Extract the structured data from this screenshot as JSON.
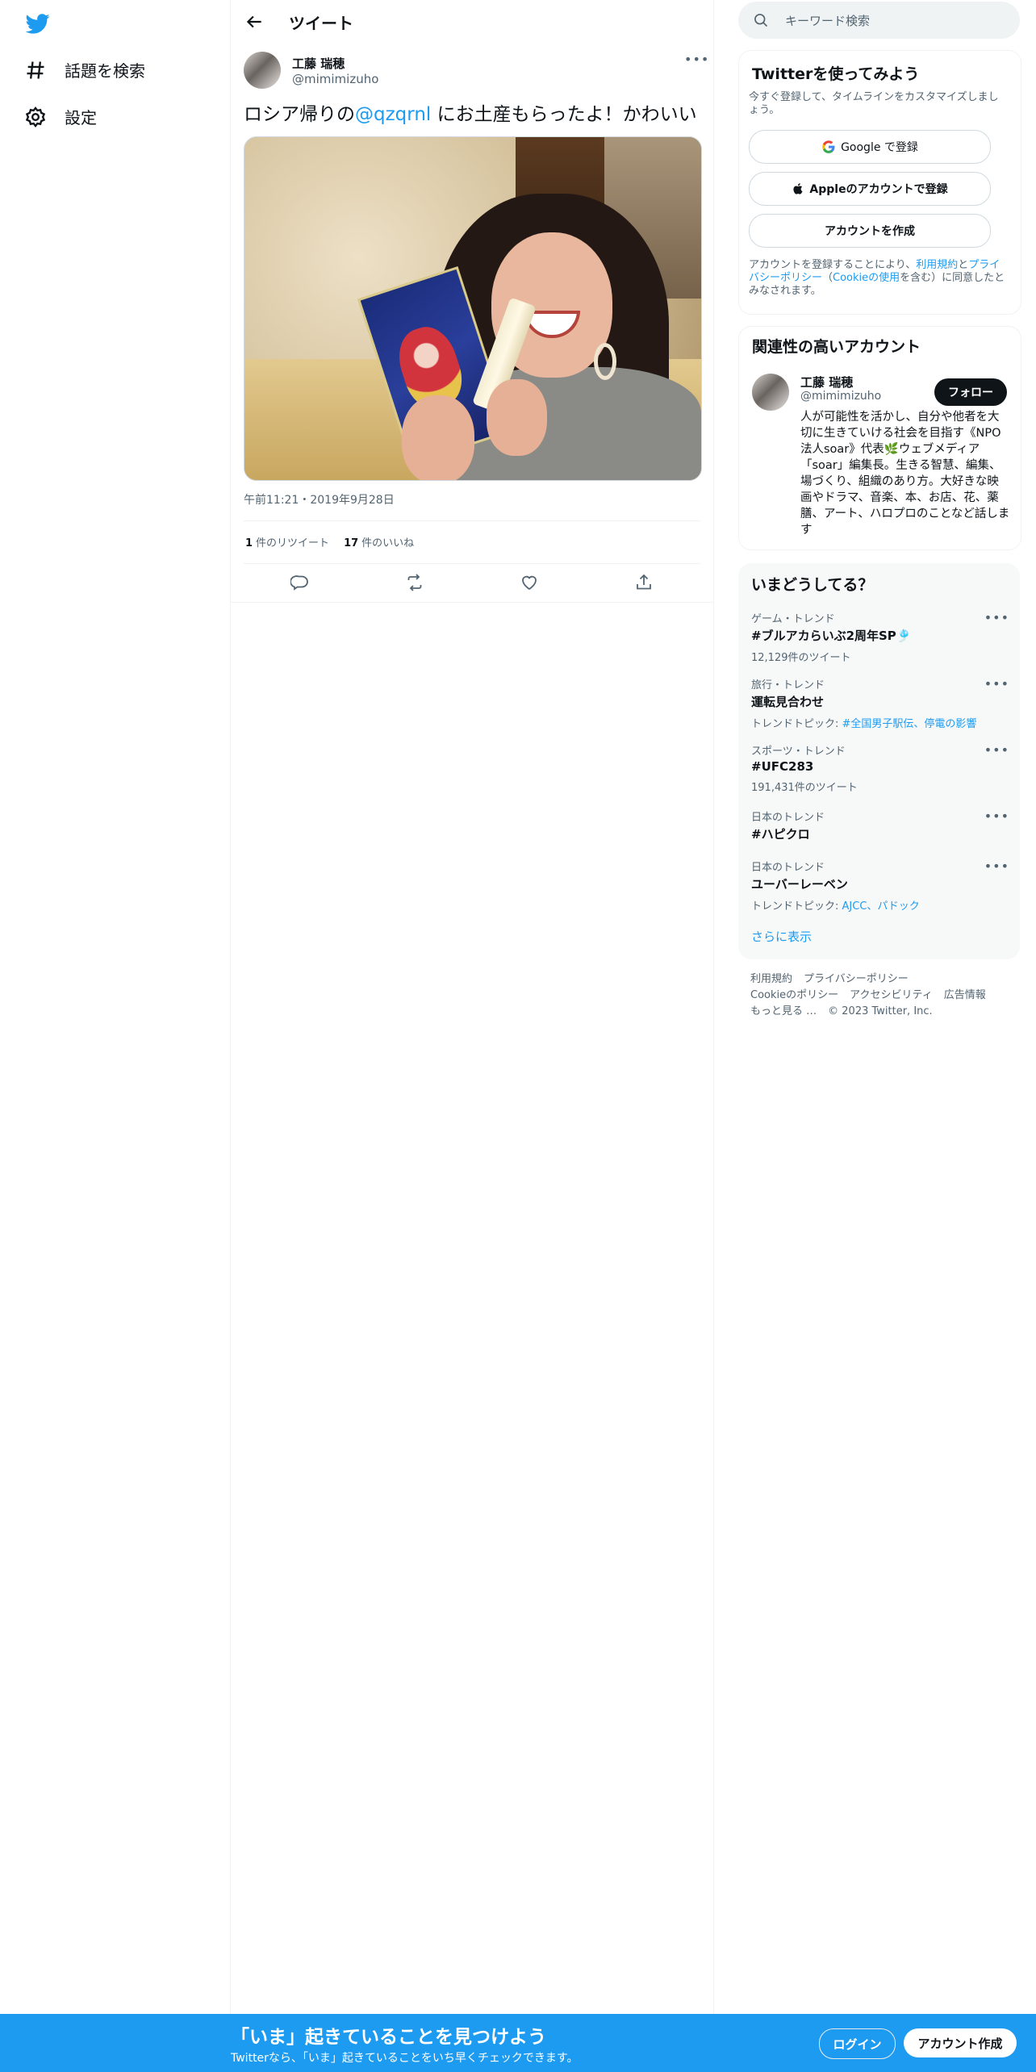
{
  "nav": {
    "items": [
      {
        "label": "話題を検索",
        "icon": "hashtag-icon"
      },
      {
        "label": "設定",
        "icon": "gear-icon"
      }
    ]
  },
  "header": {
    "title": "ツイート"
  },
  "tweet": {
    "author_name": "工藤 瑞穂",
    "author_handle": "@mimimizuho",
    "text_before": "ロシア帰りの",
    "mention": "@qzqrnl",
    "text_after": " にお土産もらったよ！かわいい",
    "timestamp": "午前11:21・2019年9月28日",
    "retweet_count": "1",
    "retweet_label": "件のリツイート",
    "like_count": "17",
    "like_label": "件のいいね"
  },
  "search": {
    "placeholder": "キーワード検索"
  },
  "signup": {
    "title": "Twitterを使ってみよう",
    "description": "今すぐ登録して、タイムラインをカスタマイズしましょう。",
    "google_label": "Google で登録",
    "apple_label": "Appleのアカウントで登録",
    "create_label": "アカウントを作成",
    "terms_pre": "アカウントを登録することにより、",
    "terms_link": "利用規約",
    "terms_mid": "と",
    "privacy_link": "プライバシーポリシー",
    "cookie_pre": "（",
    "cookie_link": "Cookieの使用",
    "terms_post": "を含む）に同意したとみなされます。"
  },
  "related": {
    "title": "関連性の高いアカウント",
    "name": "工藤 瑞穂",
    "handle": "@mimimizuho",
    "follow_label": "フォロー",
    "bio": "人が可能性を活かし、自分や他者を大切に生きていける社会を目指す《NPO法人soar》代表🌿ウェブメディア「soar」編集長。生きる智慧、編集、場づくり、組織のあり方。大好きな映画やドラマ、音楽、本、お店、花、薬膳、アート、ハロプロのことなど話します"
  },
  "trends": {
    "title": "いまどうしてる？",
    "items": [
      {
        "meta": "ゲーム・トレンド",
        "name": "#ブルアカらいぶ2周年SP🎐",
        "sub": "12,129件のツイート",
        "sub_prefix": "",
        "sub_links": ""
      },
      {
        "meta": "旅行・トレンド",
        "name": "運転見合わせ",
        "sub": "",
        "sub_prefix": "トレンドトピック: ",
        "sub_links": "#全国男子駅伝、停電の影響"
      },
      {
        "meta": "スポーツ・トレンド",
        "name": "#UFC283",
        "sub": "191,431件のツイート",
        "sub_prefix": "",
        "sub_links": ""
      },
      {
        "meta": "日本のトレンド",
        "name": "#ハピクロ",
        "sub": "",
        "sub_prefix": "",
        "sub_links": ""
      },
      {
        "meta": "日本のトレンド",
        "name": "ユーバーレーベン",
        "sub": "",
        "sub_prefix": "トレンドトピック: ",
        "sub_links": "AJCC、パドック"
      }
    ],
    "show_more": "さらに表示"
  },
  "footer": {
    "links": [
      "利用規約",
      "プライバシーポリシー",
      "Cookieのポリシー",
      "アクセシビリティ",
      "広告情報",
      "もっと見る …"
    ],
    "copyright": "© 2023 Twitter, Inc."
  },
  "bottom_bar": {
    "title": "「いま」起きていることを見つけよう",
    "subtitle": "Twitterなら、「いま」起きていることをいち早くチェックできます。",
    "login_label": "ログイン",
    "signup_label": "アカウント作成"
  },
  "colors": {
    "accent": "#1d9bf0",
    "text": "#0f1419",
    "secondary": "#536471"
  }
}
